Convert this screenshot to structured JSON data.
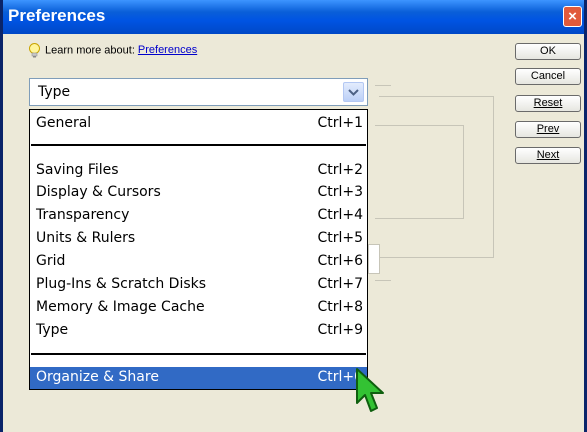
{
  "window": {
    "title": "Preferences",
    "close_glyph": "×"
  },
  "help": {
    "prefix": "Learn more about:",
    "link": "Preferences",
    "icon": "lightbulb-icon"
  },
  "buttons": {
    "ok": "OK",
    "cancel": "Cancel",
    "reset": "Reset",
    "prev": "Prev",
    "next": "Next"
  },
  "category_select": {
    "value": "Type"
  },
  "menu": {
    "general": {
      "label": "General",
      "shortcut": "Ctrl+1"
    },
    "items": [
      {
        "label": "Saving Files",
        "shortcut": "Ctrl+2"
      },
      {
        "label": "Display & Cursors",
        "shortcut": "Ctrl+3"
      },
      {
        "label": "Transparency",
        "shortcut": "Ctrl+4"
      },
      {
        "label": "Units & Rulers",
        "shortcut": "Ctrl+5"
      },
      {
        "label": "Grid",
        "shortcut": "Ctrl+6"
      },
      {
        "label": "Plug-Ins & Scratch Disks",
        "shortcut": "Ctrl+7"
      },
      {
        "label": "Memory & Image Cache",
        "shortcut": "Ctrl+8"
      },
      {
        "label": "Type",
        "shortcut": "Ctrl+9"
      }
    ],
    "organize": {
      "label": "Organize & Share",
      "shortcut": "Ctrl+0",
      "highlighted": true
    }
  },
  "colors": {
    "title_bar": "#0054e3",
    "selection": "#316ac5",
    "dialog_bg": "#ece9d8",
    "cursor": "#2fb52f"
  }
}
